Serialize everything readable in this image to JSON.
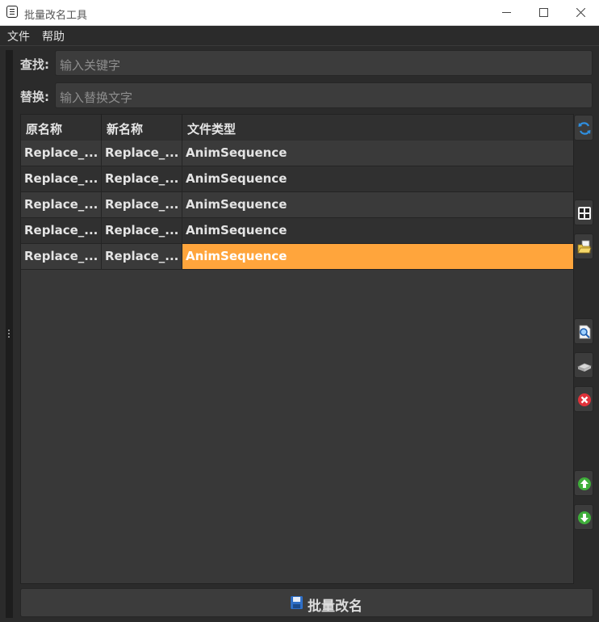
{
  "window": {
    "title": "批量改名工具"
  },
  "menu": [
    "文件",
    "帮助"
  ],
  "find": {
    "label": "查找:",
    "placeholder": "输入关键字"
  },
  "replace": {
    "label": "替换:",
    "placeholder": "输入替换文字"
  },
  "table": {
    "columns": [
      "原名称",
      "新名称",
      "文件类型"
    ],
    "rows": [
      [
        "Replace_...",
        "Replace_...",
        "AnimSequence"
      ],
      [
        "Replace_...",
        "Replace_...",
        "AnimSequence"
      ],
      [
        "Replace_...",
        "Replace_...",
        "AnimSequence"
      ],
      [
        "Replace_...",
        "Replace_...",
        "AnimSequence"
      ],
      [
        "Replace_...",
        "Replace_...",
        "AnimSequence"
      ]
    ],
    "selected_row": 4
  },
  "side_buttons": [
    "refresh-icon",
    "grid-icon",
    "open-folder-icon",
    "find-document-icon",
    "disk-icon",
    "remove-icon",
    "arrow-up-icon",
    "arrow-down-icon"
  ],
  "action": {
    "label": "批量改名",
    "icon": "save-icon"
  },
  "colors": {
    "background": "#2b2b2b",
    "selection": "#ffa53c",
    "row_alt": "#303030"
  }
}
